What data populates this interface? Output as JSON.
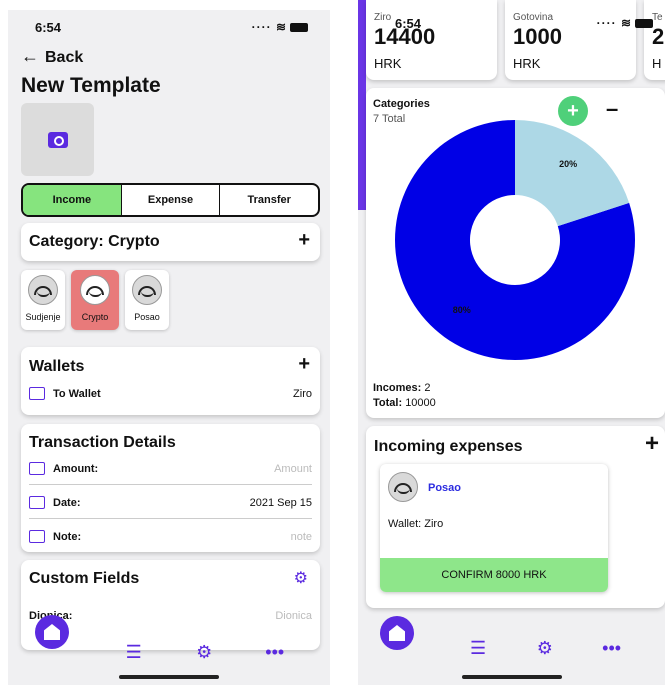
{
  "left": {
    "status": {
      "time": "6:54"
    },
    "back_label": "Back",
    "title": "New Template",
    "segments": [
      "Income",
      "Expense",
      "Transfer"
    ],
    "category_header": "Category: Crypto",
    "categories": [
      "Sudjenje",
      "Crypto",
      "Posao"
    ],
    "wallets": {
      "header": "Wallets",
      "to_wallet_label": "To Wallet",
      "to_wallet_value": "Ziro"
    },
    "transaction": {
      "header": "Transaction Details",
      "amount_label": "Amount:",
      "amount_placeholder": "Amount",
      "date_label": "Date:",
      "date_value": "2021 Sep 15",
      "note_label": "Note:",
      "note_placeholder": "note"
    },
    "custom_fields": {
      "header": "Custom Fields",
      "dionica_label": "Dionica:",
      "dionica_placeholder": "Dionica"
    }
  },
  "right": {
    "status": {
      "time": "6:54"
    },
    "wallets": [
      {
        "name": "Ziro",
        "value": "14400",
        "currency": "HRK"
      },
      {
        "name": "Gotovina",
        "value": "1000",
        "currency": "HRK"
      },
      {
        "name": "Te",
        "value": "2",
        "currency": "H"
      }
    ],
    "categories": {
      "title": "Categories",
      "total": "7 Total",
      "incomes_label": "Incomes:",
      "incomes_value": "2",
      "total_label": "Total:",
      "total_value": "10000"
    },
    "incoming": {
      "title": "Incoming expenses",
      "category": "Posao",
      "wallet": "Wallet: Ziro",
      "confirm": "CONFIRM 8000 HRK"
    }
  },
  "colors": {
    "accent": "#5b2ae0",
    "active_segment": "#86e47e",
    "selected_category": "#e87a7a",
    "confirm": "#8ee68a",
    "pie_main": "#0000e6",
    "pie_secondary": "#add8e6"
  },
  "chart_data": {
    "type": "pie",
    "title": "Categories",
    "categories": [
      "80%",
      "20%"
    ],
    "values": [
      80,
      20
    ],
    "colors": [
      "#0000e6",
      "#add8e6"
    ]
  }
}
